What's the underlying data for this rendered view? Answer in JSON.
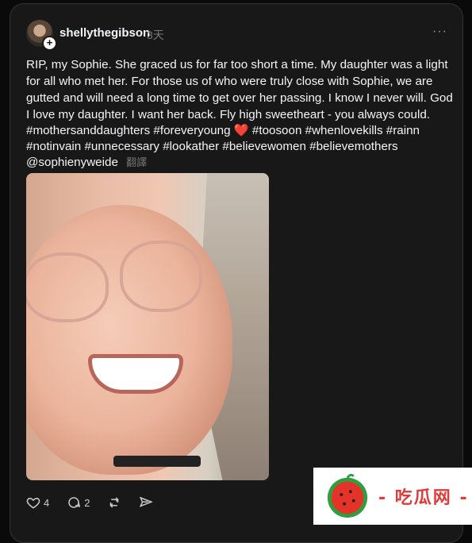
{
  "post": {
    "username": "shellythegibson",
    "time": "3天",
    "more": "···",
    "text": "RIP, my Sophie. She graced us for far too short a time. My daughter was a light for all who met her. For those us of who were truly close with Sophie, we are gutted and will need a long time to get over her passing. I know I never will. God I love my daughter. I want her back. Fly high sweetheart - you always could.",
    "tags_part1": "#mothersanddaughters #foreveryoung",
    "heart_emoji": "❤️",
    "tags_part2": " #toosoon #whenlovekills #rainn #notinvain #unnecessary #lookather #believewomen #believemothers @sophienyweide",
    "translate": "翻譯",
    "likes": "4",
    "comments": "2"
  },
  "watermark": {
    "text": "- 吃瓜网 -"
  },
  "icons": [
    "heart-icon",
    "comment-icon",
    "repost-icon",
    "share-icon",
    "more-icon"
  ]
}
